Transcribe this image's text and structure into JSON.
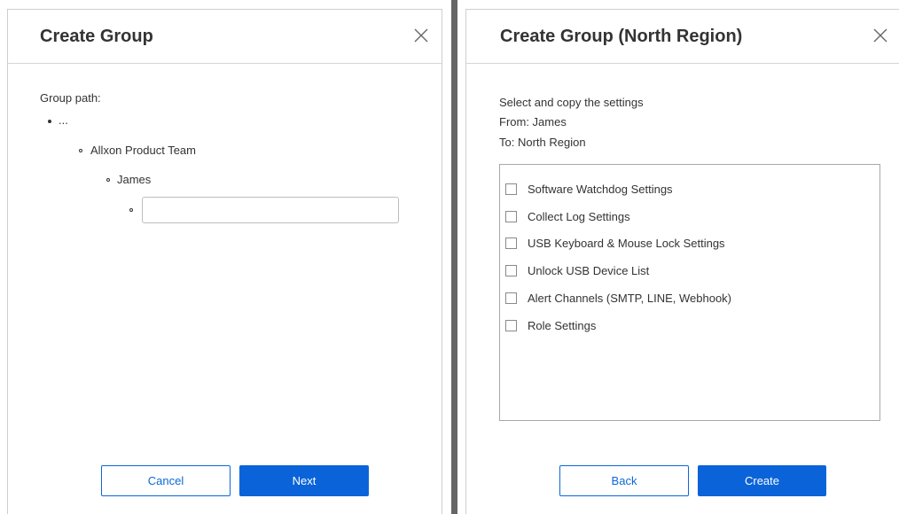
{
  "left_dialog": {
    "title": "Create Group",
    "group_path_label": "Group path:",
    "path_items": [
      "...",
      "Allxon Product Team",
      "James"
    ],
    "new_group_input": {
      "value": "",
      "placeholder": ""
    },
    "cancel_label": "Cancel",
    "next_label": "Next"
  },
  "right_dialog": {
    "title": "Create Group (North Region)",
    "instruction": "Select and copy the settings",
    "from_text": "From: James",
    "to_text": "To: North Region",
    "settings": [
      {
        "label": "Software Watchdog Settings",
        "checked": false
      },
      {
        "label": "Collect Log Settings",
        "checked": false
      },
      {
        "label": "USB Keyboard & Mouse Lock Settings",
        "checked": false
      },
      {
        "label": "Unlock USB Device List",
        "checked": false
      },
      {
        "label": "Alert Channels (SMTP, LINE, Webhook)",
        "checked": false
      },
      {
        "label": "Role Settings",
        "checked": false
      }
    ],
    "back_label": "Back",
    "create_label": "Create"
  },
  "colors": {
    "primary": "#0b63d9",
    "border": "#cfcfcf",
    "text": "#333333"
  },
  "icons": [
    "close-icon"
  ]
}
